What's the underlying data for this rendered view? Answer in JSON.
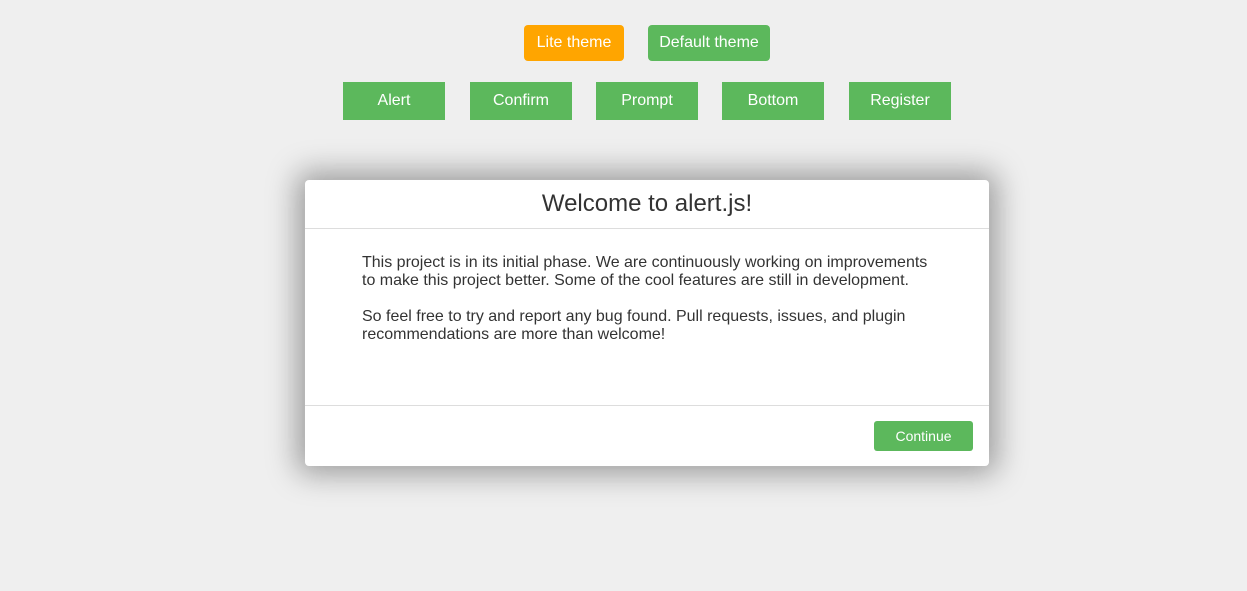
{
  "theme_buttons": {
    "lite": "Lite theme",
    "default": "Default theme"
  },
  "demo_buttons": [
    "Alert",
    "Confirm",
    "Prompt",
    "Bottom",
    "Register"
  ],
  "modal": {
    "title": "Welcome to alert.js!",
    "paragraphs": [
      "This project is in its initial phase. We are continuously working on improvements to make this project better. Some of the cool features are still in development.",
      "So feel free to try and report any bug found. Pull requests, issues, and plugin recommendations are more than welcome!"
    ],
    "continue_label": "Continue"
  },
  "colors": {
    "background": "#efefef",
    "accent_green": "#5cb85c",
    "accent_orange": "#ffa500"
  }
}
